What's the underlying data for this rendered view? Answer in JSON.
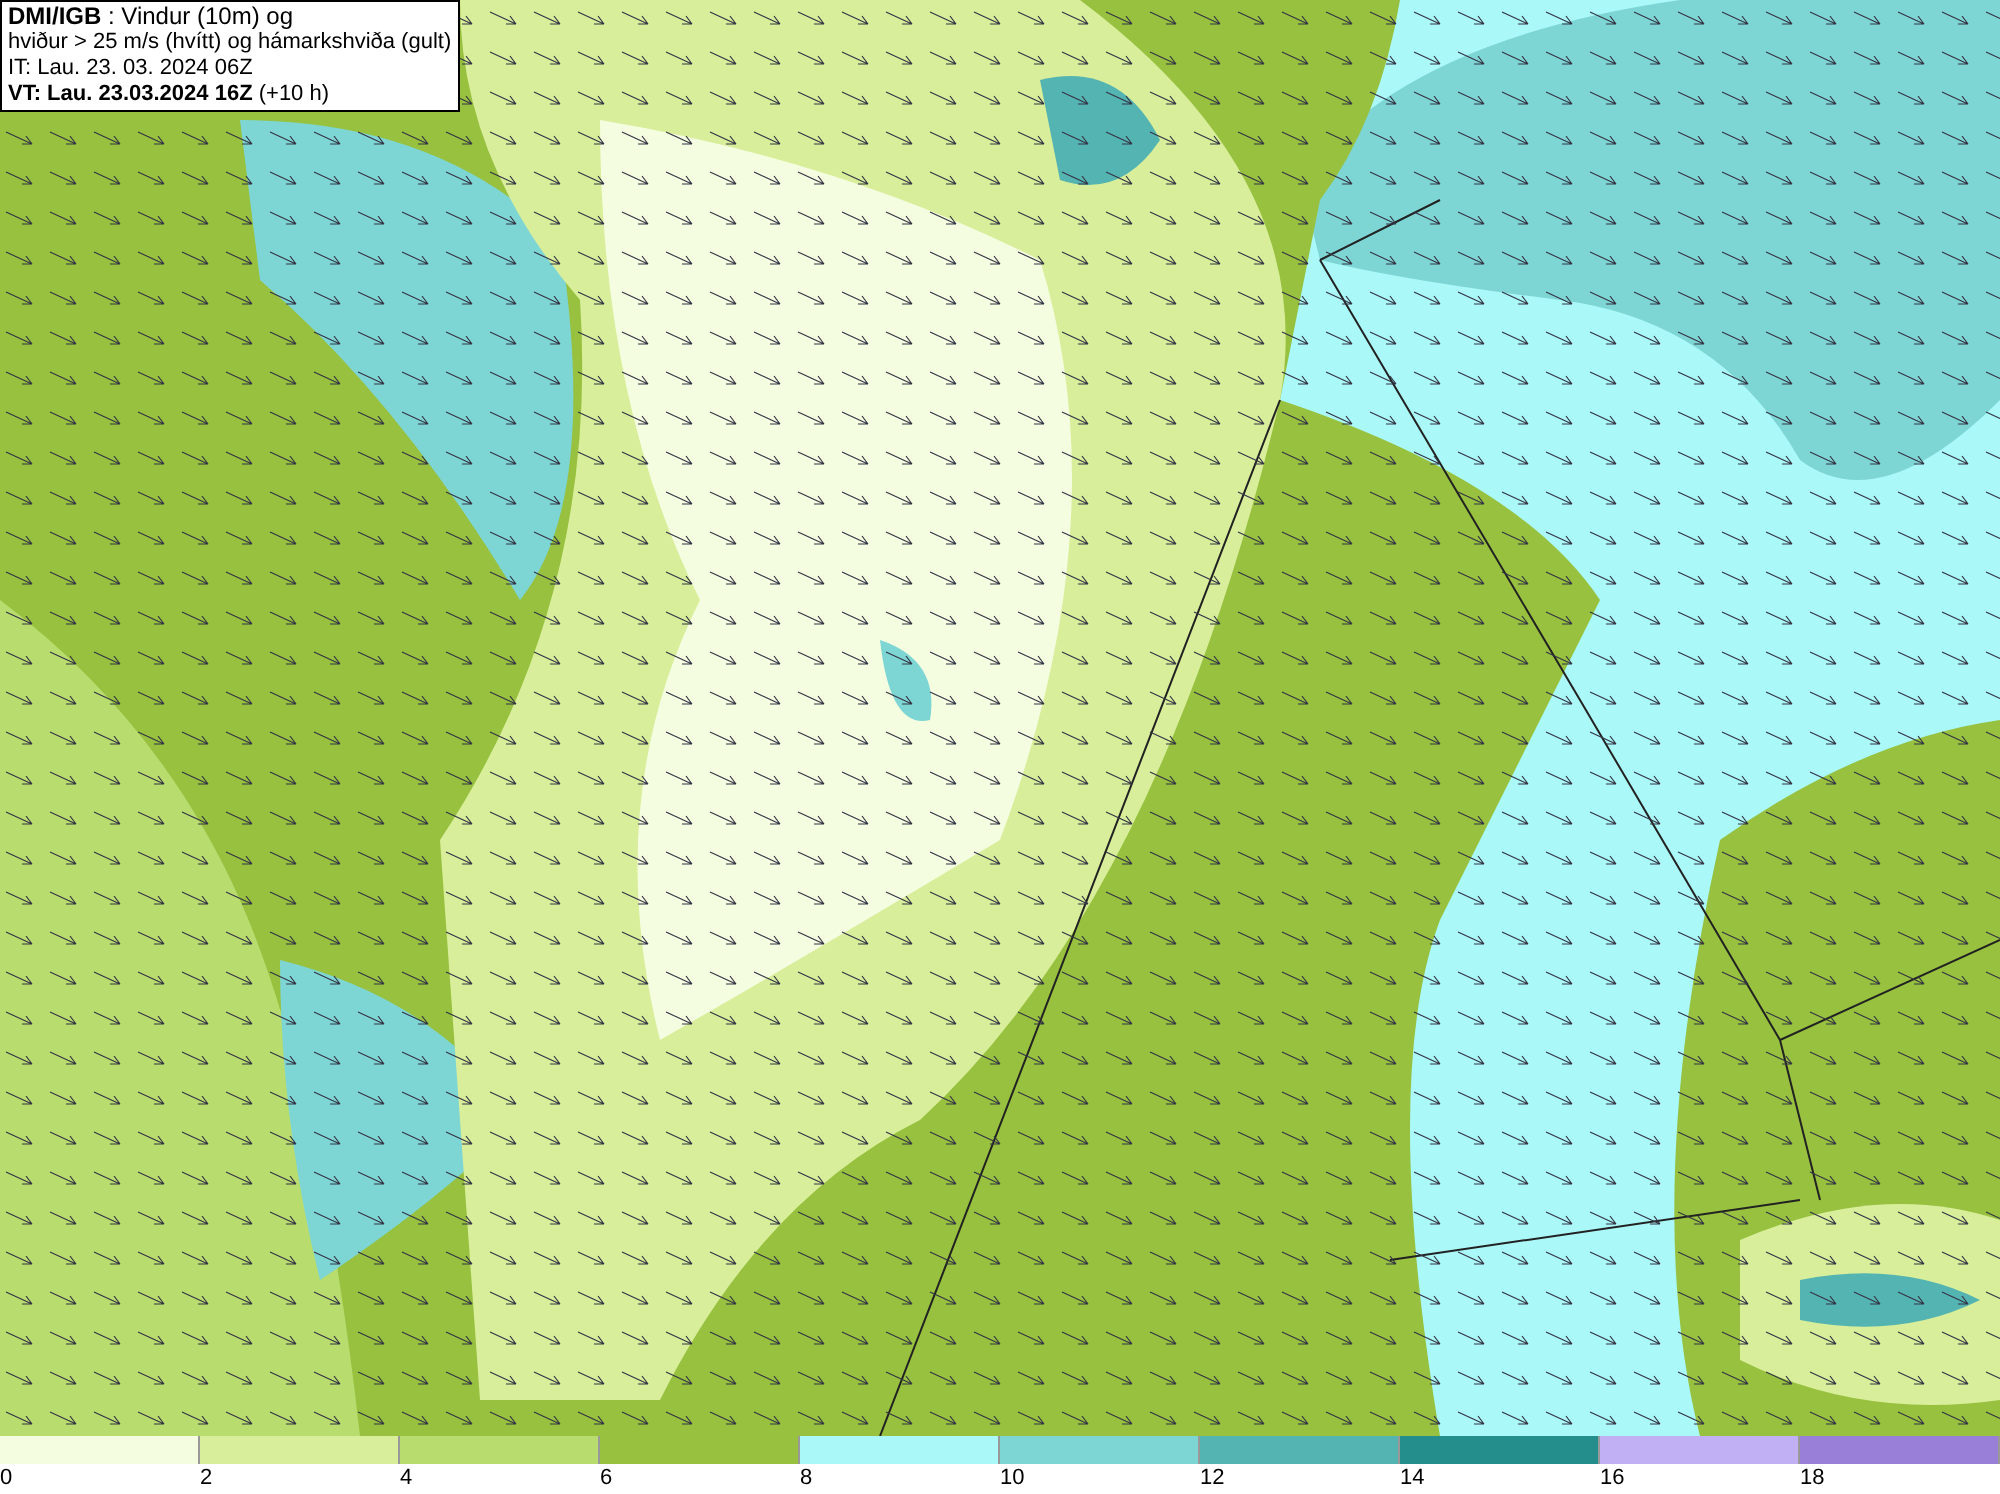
{
  "info_box": {
    "lines": [
      "**DMI/IGB** : Vindur (10m) og",
      "hviður > 25 m/s (hvítt) og hámarkshviða (gult)",
      "IT: Lau. 23. 03. 2024 06Z",
      "**VT: Lau. 23.03.2024 16Z** (+10 h)"
    ]
  },
  "legend": {
    "bins": [
      {
        "label": "0",
        "color": "#f5fde0"
      },
      {
        "label": "2",
        "color": "#d8ee9a"
      },
      {
        "label": "4",
        "color": "#b9dc6e"
      },
      {
        "label": "6",
        "color": "#97c13e"
      },
      {
        "label": "8",
        "color": "#aaf8f8"
      },
      {
        "label": "10",
        "color": "#7ed6d4"
      },
      {
        "label": "12",
        "color": "#54b4b2"
      },
      {
        "label": "14",
        "color": "#238e8c"
      },
      {
        "label": "16",
        "color": "#c2b0f4"
      },
      {
        "label": "18",
        "color": "#9a7fd9"
      }
    ]
  }
}
